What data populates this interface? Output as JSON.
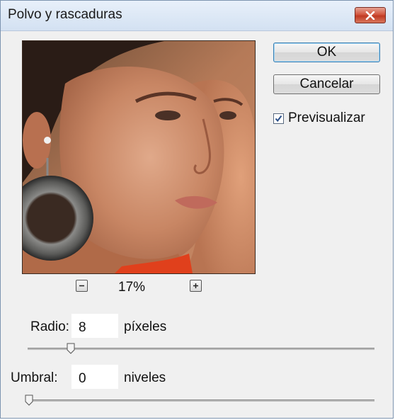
{
  "dialog": {
    "title": "Polvo y rascaduras"
  },
  "buttons": {
    "ok_label": "OK",
    "cancel_label": "Cancelar"
  },
  "preview_toggle": {
    "label": "Previsualizar",
    "checked": true
  },
  "zoom": {
    "value": "17%"
  },
  "radius": {
    "label": "Radio:",
    "value": "8",
    "unit": "píxeles",
    "slider_level": 0.12
  },
  "threshold": {
    "label": "Umbral:",
    "value": "0",
    "unit": "niveles",
    "slider_level": 0.0
  },
  "colors": {
    "title_bar": "#d3e1f2",
    "close_button": "#c03a22",
    "dialog_bg": "#f0f0f0",
    "accent_border": "#3c7fb1"
  },
  "icons": [
    "close-icon",
    "checkmark-icon",
    "minus-icon",
    "plus-icon",
    "slider-thumb-icon"
  ]
}
